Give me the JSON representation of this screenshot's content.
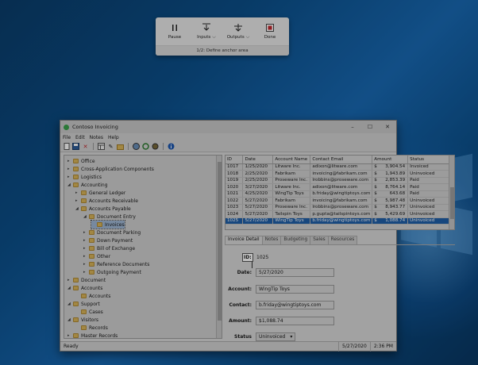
{
  "recorder": {
    "buttons": [
      {
        "label": "Pause",
        "icon": "pause-icon"
      },
      {
        "label": "Inputs",
        "icon": "inputs-icon"
      },
      {
        "label": "Outputs",
        "icon": "outputs-icon"
      },
      {
        "label": "Done",
        "icon": "stop-icon"
      }
    ],
    "status": "1/2: Define anchor area"
  },
  "window": {
    "title": "Contoso Invoicing",
    "menu": [
      "File",
      "Edit",
      "Notes",
      "Help"
    ]
  },
  "tree": [
    {
      "label": "Office",
      "level": 0,
      "expander": "▸"
    },
    {
      "label": "Cross-Application Components",
      "level": 0,
      "expander": "▸"
    },
    {
      "label": "Logistics",
      "level": 0,
      "expander": "▸"
    },
    {
      "label": "Accounting",
      "level": 0,
      "expander": "◢"
    },
    {
      "label": "General Ledger",
      "level": 1,
      "expander": "▸"
    },
    {
      "label": "Accounts Receivable",
      "level": 1,
      "expander": "▸"
    },
    {
      "label": "Accounts Payable",
      "level": 1,
      "expander": "◢"
    },
    {
      "label": "Document Entry",
      "level": 2,
      "expander": "◢"
    },
    {
      "label": "Invoices",
      "level": 3,
      "expander": "",
      "selected": true
    },
    {
      "label": "Document Parking",
      "level": 2,
      "expander": "▸"
    },
    {
      "label": "Down Payment",
      "level": 2,
      "expander": "▸"
    },
    {
      "label": "Bill of Exchange",
      "level": 2,
      "expander": "▸"
    },
    {
      "label": "Other",
      "level": 2,
      "expander": "▸"
    },
    {
      "label": "Reference Documents",
      "level": 2,
      "expander": "▸"
    },
    {
      "label": "Outgoing Payment",
      "level": 2,
      "expander": "▸"
    },
    {
      "label": "Document",
      "level": 0,
      "expander": "▸"
    },
    {
      "label": "Accounts",
      "level": 0,
      "expander": "◢"
    },
    {
      "label": "Accounts",
      "level": 1,
      "expander": ""
    },
    {
      "label": "Support",
      "level": 0,
      "expander": "◢"
    },
    {
      "label": "Cases",
      "level": 1,
      "expander": ""
    },
    {
      "label": "Visitors",
      "level": 0,
      "expander": "◢"
    },
    {
      "label": "Records",
      "level": 1,
      "expander": ""
    },
    {
      "label": "Master Records",
      "level": 0,
      "expander": "▸"
    }
  ],
  "grid": {
    "columns": [
      "ID",
      "Date",
      "Account Name",
      "Contact Email",
      "Amount",
      "Status"
    ],
    "rows": [
      [
        "1017",
        "1/25/2020",
        "Litware Inc.",
        "adixon@litware.com",
        "3,904.54",
        "Invoiced"
      ],
      [
        "1018",
        "2/25/2020",
        "Fabrikam",
        "invoicing@fabrikam.com",
        "1,943.89",
        "Uninvoiced"
      ],
      [
        "1019",
        "2/25/2020",
        "Proseware Inc.",
        "lrobbins@proseware.com",
        "2,853.39",
        "Paid"
      ],
      [
        "1020",
        "3/27/2020",
        "Litware Inc.",
        "adixon@litware.com",
        "8,764.14",
        "Paid"
      ],
      [
        "1021",
        "4/25/2020",
        "WingTip Toys",
        "b.friday@wingtiptoys.com",
        "643.68",
        "Paid"
      ],
      [
        "1022",
        "5/27/2020",
        "Fabrikam",
        "invoicing@fabrikam.com",
        "5,987.48",
        "Uninvoiced"
      ],
      [
        "1023",
        "5/27/2020",
        "Proseware Inc.",
        "lrobbins@proseware.com",
        "8,943.77",
        "Uninvoiced"
      ],
      [
        "1024",
        "5/27/2020",
        "Tailspin Toys",
        "p.gupta@tailspintoys.com",
        "5,429.69",
        "Uninvoiced"
      ],
      [
        "1025",
        "5/27/2020",
        "WingTip Toys",
        "b.friday@wingtiptoys.com",
        "1,088.74",
        "Uninvoiced"
      ]
    ],
    "selected_index": 8,
    "currency": "$"
  },
  "tabs": [
    "Invoice Detail",
    "Notes",
    "Budgeting",
    "Sales",
    "Resources"
  ],
  "detail": {
    "id_label": "ID:",
    "id_value": "1025",
    "date_label": "Date:",
    "date_value": "5/27/2020",
    "account_label": "Account:",
    "account_value": "WingTip Toys",
    "contact_label": "Contact:",
    "contact_value": "b.friday@wingtiptoys.com",
    "amount_label": "Amount:",
    "amount_value": "$1,088.74",
    "status_label": "Status",
    "status_value": "Uninvoiced"
  },
  "statusbar": {
    "left": "Ready",
    "date": "5/27/2020",
    "time": "2:36 PM"
  }
}
